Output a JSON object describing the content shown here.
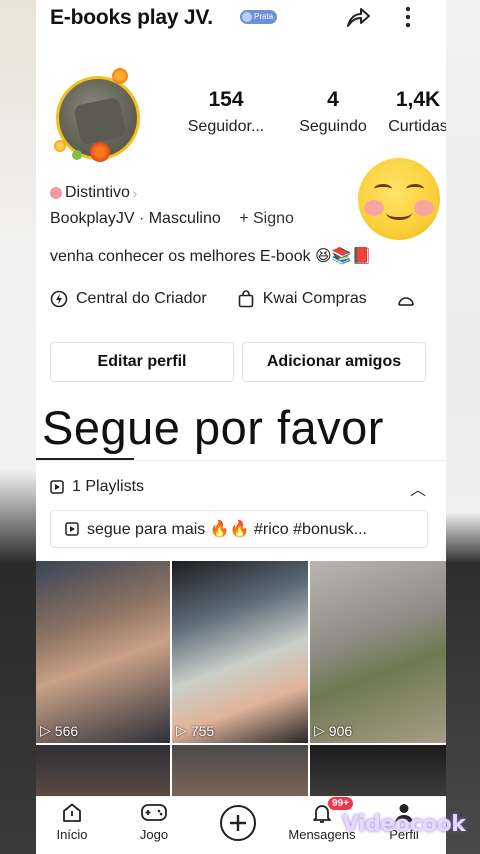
{
  "profile": {
    "name": "E-books play JV.",
    "badge": "Prata",
    "stats": [
      {
        "value": "154",
        "label": "Seguidor..."
      },
      {
        "value": "4",
        "label": "Seguindo"
      },
      {
        "value": "1,4K",
        "label": "Curtidas"
      }
    ],
    "distintivo": "Distintivo",
    "bio_line1_a": "BookplayJV · Masculino",
    "bio_line1_b": "+ Signo",
    "bio_line2": "venha conhecer os melhores E-book 😆📚📕"
  },
  "creator_row": {
    "central": "Central do Criador",
    "compras": "Kwai Compras"
  },
  "buttons": {
    "edit": "Editar perfil",
    "add": "Adicionar amigos"
  },
  "overlay_text": "Segue por favor",
  "playlists": {
    "header": "1 Playlists",
    "chip": "segue para mais 🔥🔥 #rico #bonusk..."
  },
  "videos": [
    {
      "views": "566"
    },
    {
      "views": "755"
    },
    {
      "views": "906"
    }
  ],
  "nav": {
    "items": [
      {
        "label": "Início"
      },
      {
        "label": "Jogo"
      },
      {
        "label": ""
      },
      {
        "label": "Mensagens"
      },
      {
        "label": "Perfil"
      }
    ],
    "badge": "99+"
  },
  "watermark": "Videocook"
}
